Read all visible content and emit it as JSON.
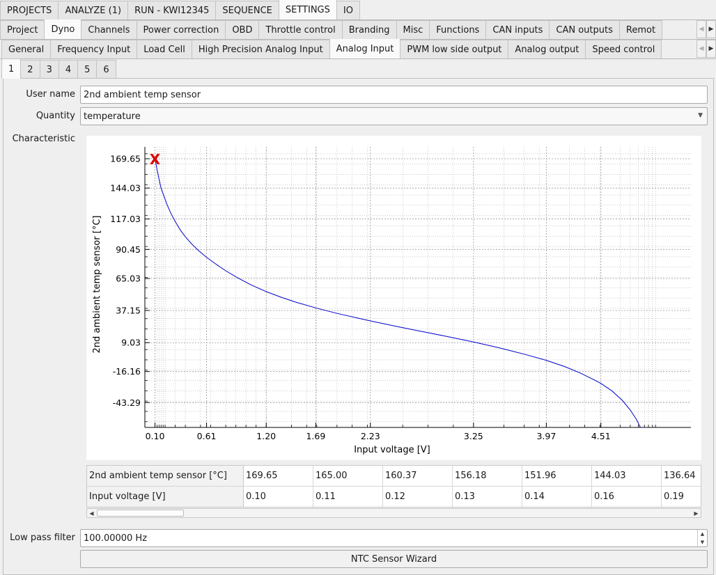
{
  "main_tabs": [
    "PROJECTS",
    "ANALYZE (1)",
    "RUN - KWI12345",
    "SEQUENCE",
    "SETTINGS",
    "IO"
  ],
  "main_tabs_active": 4,
  "settings_tabs": [
    "Project",
    "Dyno",
    "Channels",
    "Power correction",
    "OBD",
    "Throttle control",
    "Branding",
    "Misc",
    "Functions",
    "CAN inputs",
    "CAN outputs",
    "Remot"
  ],
  "settings_tabs_active": 1,
  "dyno_tabs": [
    "General",
    "Frequency Input",
    "Load Cell",
    "High Precision Analog Input",
    "Analog Input",
    "PWM low side output",
    "Analog output",
    "Speed control"
  ],
  "dyno_tabs_active": 4,
  "channel_tabs": [
    "1",
    "2",
    "3",
    "4",
    "5",
    "6"
  ],
  "channel_tabs_active": 0,
  "form": {
    "user_name_label": "User name",
    "user_name_value": "2nd ambient temp sensor",
    "quantity_label": "Quantity",
    "quantity_value": "temperature",
    "characteristic_label": "Characteristic",
    "low_pass_label": "Low pass filter",
    "low_pass_value": "100.00000 Hz",
    "wizard_label": "NTC Sensor Wizard"
  },
  "icons": {
    "tab_scroll_left": "chevron-left-icon",
    "tab_scroll_right": "chevron-right-icon",
    "combo_caret": "chevron-down-icon",
    "marker": "x-marker-icon"
  },
  "colors": {
    "curve": "#0000cc",
    "marker": "#e00000",
    "grid": "#999999"
  },
  "chart_data": {
    "type": "line",
    "xlabel": "Input voltage [V]",
    "ylabel": "2nd ambient temp sensor [°C]",
    "x_tick_labels": [
      "0.10",
      "0.61",
      "1.20",
      "1.69",
      "2.23",
      "3.25",
      "3.97",
      "4.51"
    ],
    "y_tick_labels": [
      "169.65",
      "144.03",
      "117.03",
      "90.45",
      "65.03",
      "37.15",
      "9.03",
      "-16.16",
      "-43.29"
    ],
    "xlim": [
      0.0,
      5.4
    ],
    "ylim": [
      -65,
      180
    ],
    "marker_point": {
      "x": 0.1,
      "y": 169.65,
      "label": "X"
    },
    "series": [
      {
        "x": [
          0.1,
          0.11,
          0.12,
          0.13,
          0.14,
          0.16,
          0.19,
          0.22,
          0.26,
          0.3,
          0.35,
          0.4,
          0.46,
          0.53,
          0.61,
          0.7,
          0.8,
          0.92,
          1.05,
          1.2,
          1.35,
          1.5,
          1.69,
          1.9,
          2.1,
          2.23,
          2.5,
          2.75,
          3.0,
          3.25,
          3.5,
          3.75,
          3.97,
          4.15,
          4.3,
          4.45,
          4.51,
          4.62,
          4.72,
          4.8,
          4.86,
          4.9,
          4.93
        ],
        "y": [
          169.65,
          165.0,
          160.37,
          156.18,
          151.96,
          144.03,
          136.64,
          129.5,
          121.5,
          114.8,
          107.5,
          101.5,
          95.5,
          89.5,
          83.6,
          77.8,
          71.8,
          65.5,
          59.5,
          53.6,
          48.6,
          44.2,
          39.4,
          34.6,
          30.6,
          28.0,
          23.0,
          18.6,
          14.2,
          9.6,
          4.6,
          -1.0,
          -6.4,
          -11.8,
          -17.2,
          -23.8,
          -26.6,
          -33.2,
          -41.2,
          -49.8,
          -57.8,
          -65.0,
          -71.0
        ]
      }
    ]
  },
  "table": {
    "row_labels": [
      "2nd ambient temp sensor [°C]",
      "Input voltage [V]"
    ],
    "temps": [
      "169.65",
      "165.00",
      "160.37",
      "156.18",
      "151.96",
      "144.03",
      "136.64"
    ],
    "voltages": [
      "0.10",
      "0.11",
      "0.12",
      "0.13",
      "0.14",
      "0.16",
      "0.19"
    ]
  }
}
